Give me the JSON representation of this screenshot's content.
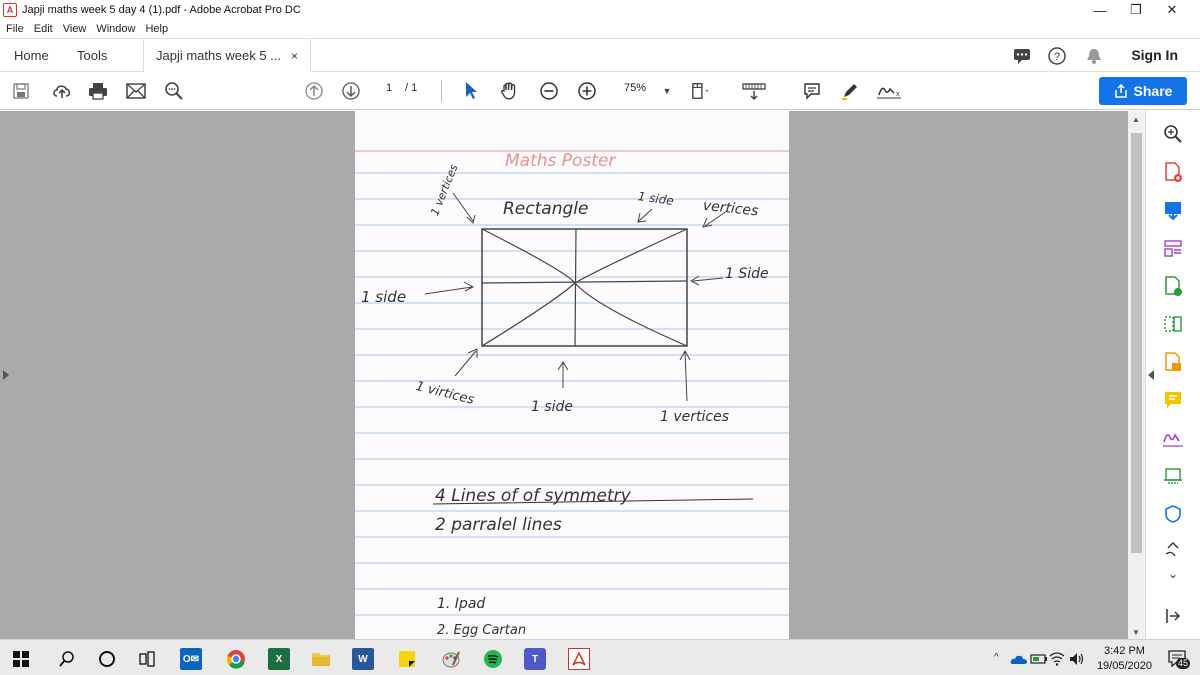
{
  "window": {
    "title": "Japji maths week 5 day 4 (1).pdf - Adobe Acrobat Pro DC",
    "app_icon": "acrobat-icon"
  },
  "menu": [
    "File",
    "Edit",
    "View",
    "Window",
    "Help"
  ],
  "tabs": {
    "home": "Home",
    "tools": "Tools",
    "document": "Japji maths week 5 ...",
    "close": "×",
    "sign_in": "Sign In"
  },
  "toolbar": {
    "page_current": "1",
    "page_total": "/ 1",
    "zoom": "75%",
    "share_label": "Share"
  },
  "document": {
    "heading": "Maths Poster",
    "shape_name": "Rectangle",
    "labels": {
      "vertices_top_left": "1 vertices",
      "side_top": "1 side",
      "vertices_top_right": "vertices",
      "side_right": "1 Side",
      "side_left": "1 side",
      "vertices_bottom_left": "1 virtices",
      "side_bottom": "1 side",
      "vertices_bottom_right": "1 vertices"
    },
    "notes": [
      "4 Lines of of symmetry",
      "2 parralel lines"
    ],
    "list": [
      "1. Ipad",
      "2. Egg Cartan"
    ]
  },
  "taskbar": {
    "time": "3:42 PM",
    "date": "19/05/2020",
    "notification_count": "45"
  },
  "colors": {
    "accent": "#1473e6",
    "workspace": "#aaaaaa",
    "paper_line": "#a9c8ea",
    "margin_line": "#e89a9a"
  }
}
